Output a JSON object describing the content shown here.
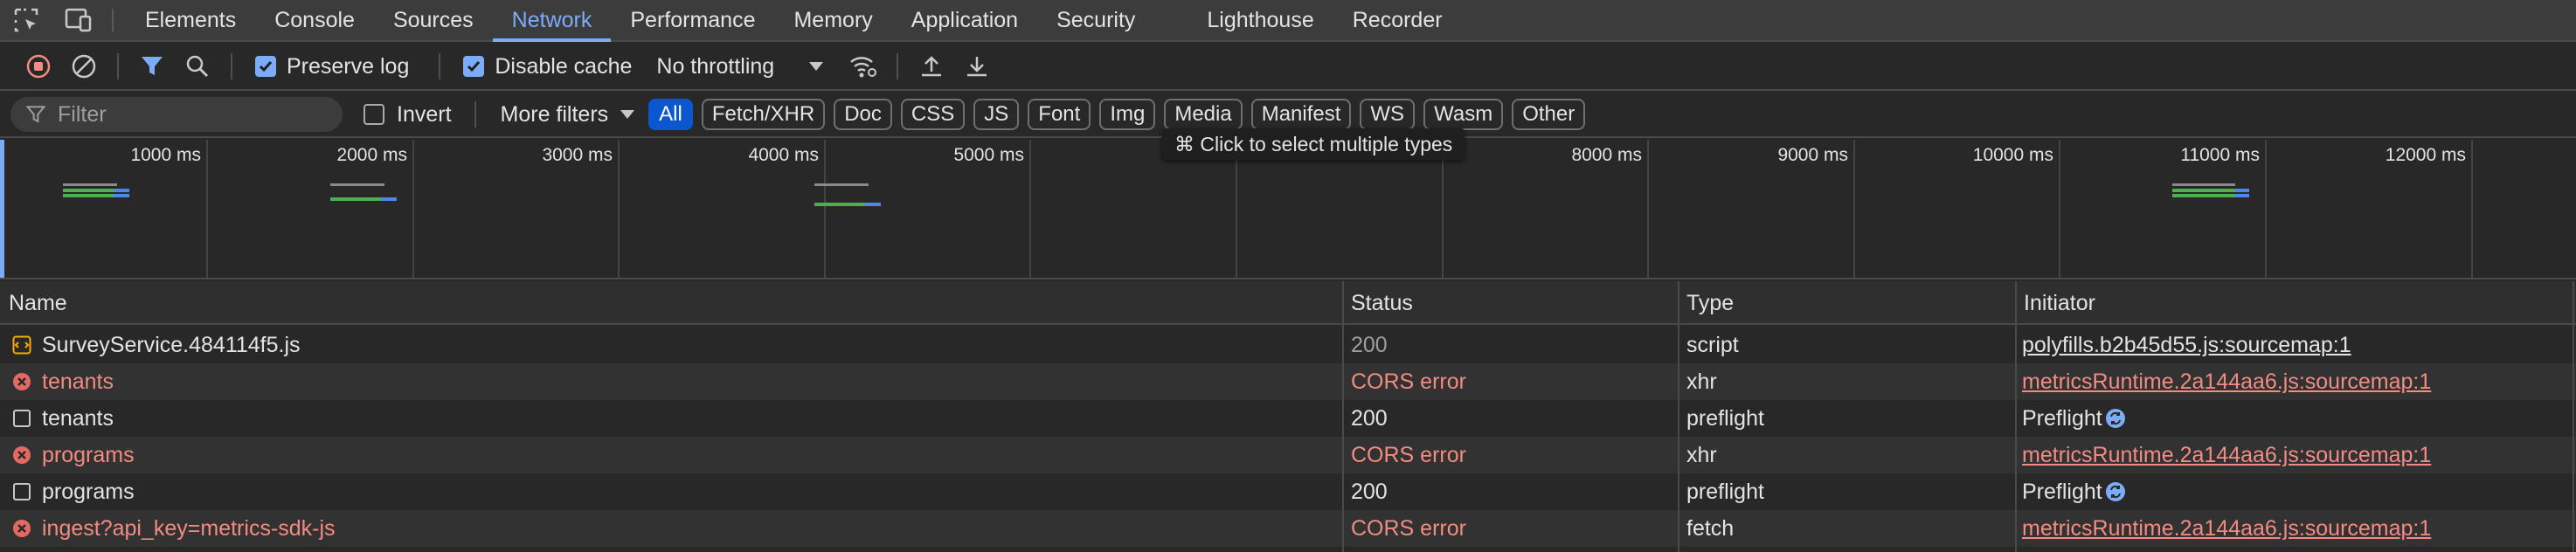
{
  "tabs": [
    {
      "label": "Elements",
      "active": false
    },
    {
      "label": "Console",
      "active": false
    },
    {
      "label": "Sources",
      "active": false
    },
    {
      "label": "Network",
      "active": true
    },
    {
      "label": "Performance",
      "active": false
    },
    {
      "label": "Memory",
      "active": false
    },
    {
      "label": "Application",
      "active": false
    },
    {
      "label": "Security",
      "active": false
    },
    {
      "label": "Lighthouse",
      "active": false
    },
    {
      "label": "Recorder",
      "active": false
    }
  ],
  "toolbar": {
    "preserve_log_label": "Preserve log",
    "preserve_log_checked": true,
    "disable_cache_label": "Disable cache",
    "disable_cache_checked": true,
    "throttling_value": "No throttling"
  },
  "filterbar": {
    "filter_placeholder": "Filter",
    "invert_label": "Invert",
    "invert_checked": false,
    "more_filters_label": "More filters",
    "type_chips": [
      {
        "label": "All",
        "active": true
      },
      {
        "label": "Fetch/XHR",
        "active": false
      },
      {
        "label": "Doc",
        "active": false
      },
      {
        "label": "CSS",
        "active": false
      },
      {
        "label": "JS",
        "active": false
      },
      {
        "label": "Font",
        "active": false
      },
      {
        "label": "Img",
        "active": false
      },
      {
        "label": "Media",
        "active": false
      },
      {
        "label": "Manifest",
        "active": false
      },
      {
        "label": "WS",
        "active": false
      },
      {
        "label": "Wasm",
        "active": false
      },
      {
        "label": "Other",
        "active": false
      }
    ]
  },
  "tooltip": {
    "text": "⌘ Click to select multiple types"
  },
  "overview": {
    "ticks": [
      "1000 ms",
      "2000 ms",
      "3000 ms",
      "4000 ms",
      "5000 ms",
      "",
      "",
      "8000 ms",
      "9000 ms",
      "10000 ms",
      "11000 ms",
      "12000 ms"
    ],
    "colors": {
      "waiting": "#4caf50",
      "download": "#4f87e8",
      "queued": "#8a8a8a"
    }
  },
  "table": {
    "columns": {
      "name": "Name",
      "status": "Status",
      "type": "Type",
      "initiator": "Initiator"
    },
    "rows": [
      {
        "icon": "script-icon",
        "name": "SurveyService.484114f5.js",
        "status": "200",
        "type": "script",
        "initiator": "polyfills.b2b45d55.js:sourcemap:1",
        "error": false,
        "status_muted": true,
        "initiator_link": true
      },
      {
        "icon": "error-icon",
        "name": "tenants",
        "status": "CORS error",
        "type": "xhr",
        "initiator": "metricsRuntime.2a144aa6.js:sourcemap:1",
        "error": true,
        "status_muted": false,
        "initiator_link": true
      },
      {
        "icon": "checkbox-icon",
        "name": "tenants",
        "status": "200",
        "type": "preflight",
        "initiator": "Preflight",
        "error": false,
        "status_muted": false,
        "initiator_link": false
      },
      {
        "icon": "error-icon",
        "name": "programs",
        "status": "CORS error",
        "type": "xhr",
        "initiator": "metricsRuntime.2a144aa6.js:sourcemap:1",
        "error": true,
        "status_muted": false,
        "initiator_link": true
      },
      {
        "icon": "checkbox-icon",
        "name": "programs",
        "status": "200",
        "type": "preflight",
        "initiator": "Preflight",
        "error": false,
        "status_muted": false,
        "initiator_link": false
      },
      {
        "icon": "error-icon",
        "name": "ingest?api_key=metrics-sdk-js",
        "status": "CORS error",
        "type": "fetch",
        "initiator": "metricsRuntime.2a144aa6.js:sourcemap:1",
        "error": true,
        "status_muted": false,
        "initiator_link": true
      }
    ]
  }
}
